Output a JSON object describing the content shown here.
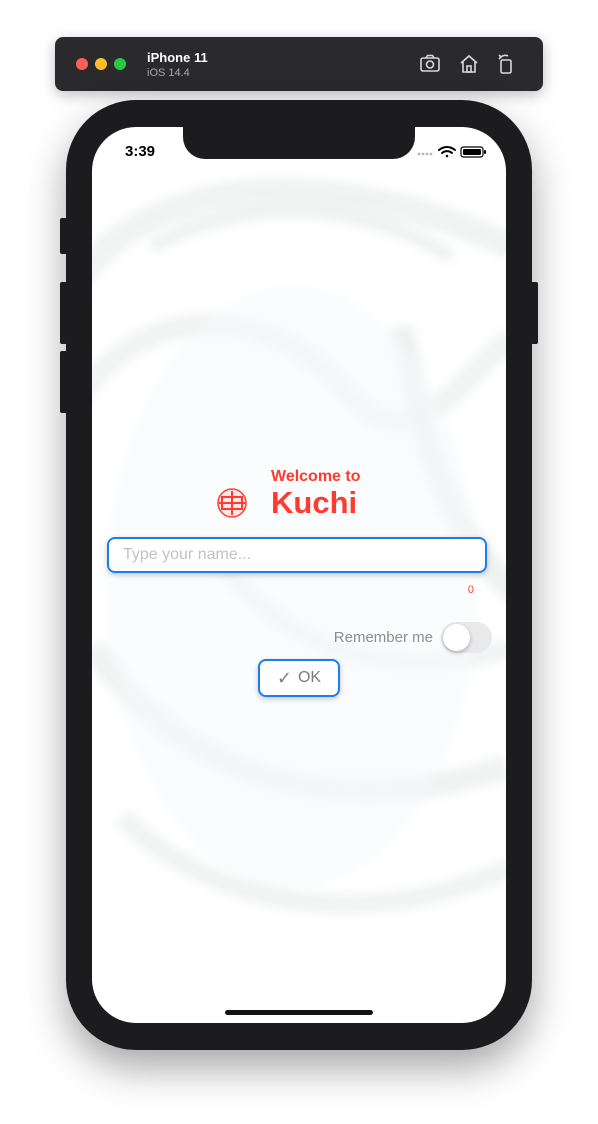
{
  "simulator": {
    "device_name": "iPhone 11",
    "os_version": "iOS 14.4",
    "toolbar_icons": [
      "screenshot-icon",
      "home-icon",
      "rotate-icon"
    ]
  },
  "status_bar": {
    "time": "3:39",
    "icons": [
      "signal-icon",
      "wifi-icon",
      "battery-icon"
    ]
  },
  "welcome": {
    "subtitle": "Welcome to",
    "app_name": "Kuchi"
  },
  "name_input": {
    "placeholder": "Type your name...",
    "value": ""
  },
  "char_count": "0",
  "remember_me": {
    "label": "Remember me",
    "enabled": false
  },
  "ok_button": {
    "label": "OK",
    "icon": "checkmark-icon"
  },
  "colors": {
    "accent": "#ff3b30",
    "border": "#1a7df2"
  }
}
